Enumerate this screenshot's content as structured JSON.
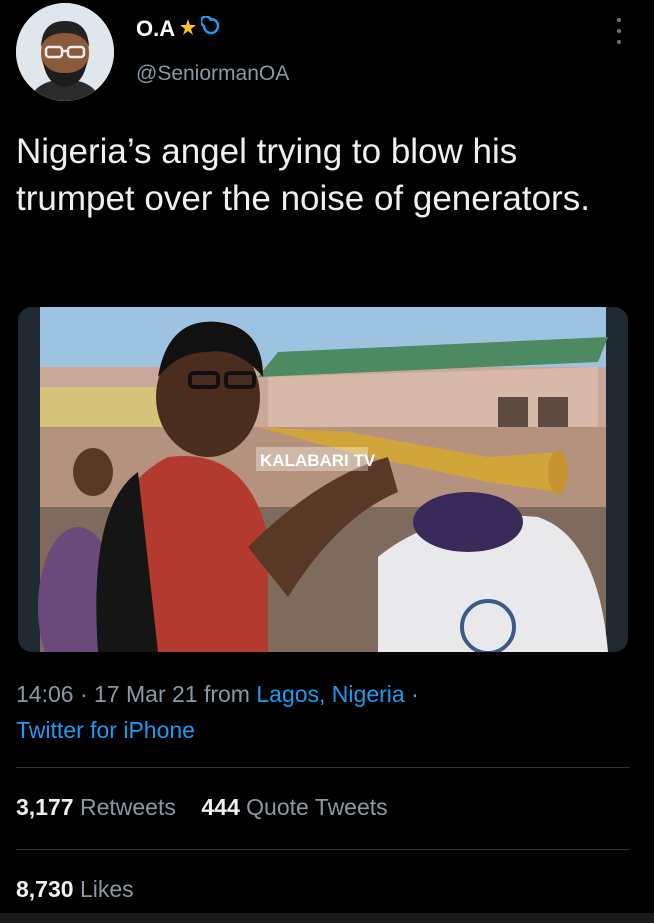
{
  "author": {
    "name": "O.A",
    "handle": "@SeniormanOA",
    "emoji_icons": [
      "star-struck-icon",
      "cyclone-icon"
    ]
  },
  "tweet": {
    "text": "Nigeria’s angel trying to blow his trumpet over the noise of generators.",
    "media_watermark": "KALABARI TV"
  },
  "meta": {
    "time": "14:06",
    "date": "17 Mar 21",
    "from_word": "from",
    "location": "Lagos, Nigeria",
    "client": "Twitter for iPhone"
  },
  "stats": {
    "retweets_count": "3,177",
    "retweets_label": "Retweets",
    "quotes_count": "444",
    "quotes_label": "Quote Tweets",
    "likes_count": "8,730",
    "likes_label": "Likes"
  },
  "colors": {
    "background": "#000000",
    "link": "#1d9bf0",
    "secondary_text": "#8b98a5"
  }
}
